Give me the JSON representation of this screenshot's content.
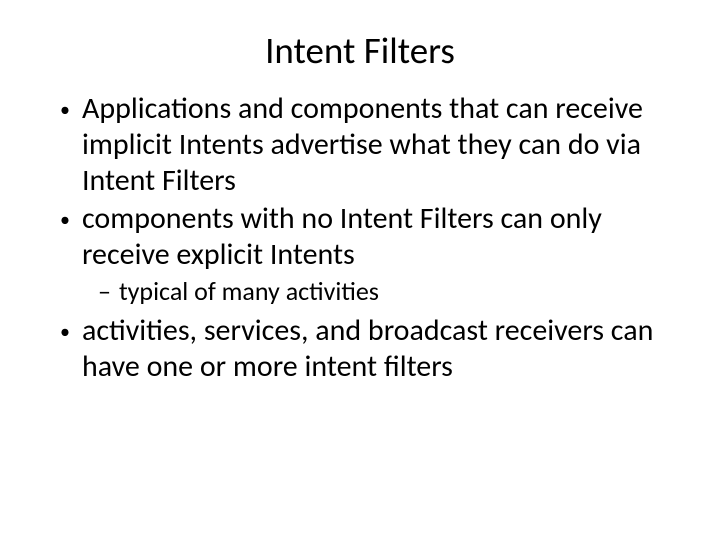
{
  "slide": {
    "title": "Intent Filters",
    "bullets": {
      "b1": "Applications and components that can receive implicit Intents advertise what they can do via Intent Filters",
      "b2": "components with no Intent Filters can only receive explicit Intents",
      "b2_sub1": "typical of many activities",
      "b3": "activities, services, and broadcast receivers can have one or more intent filters"
    }
  }
}
